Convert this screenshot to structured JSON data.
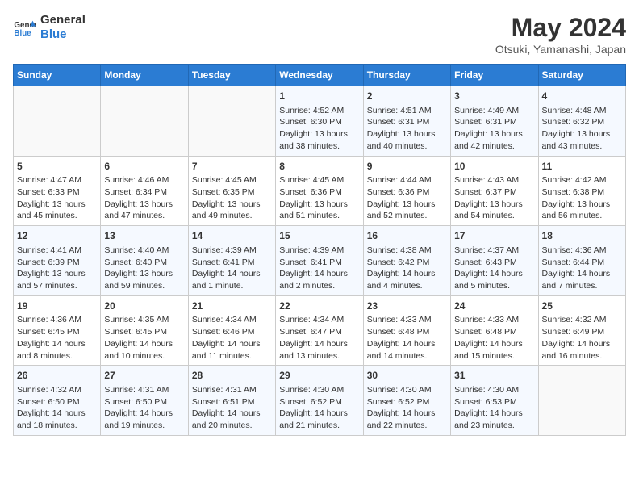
{
  "header": {
    "logo_line1": "General",
    "logo_line2": "Blue",
    "month_title": "May 2024",
    "location": "Otsuki, Yamanashi, Japan"
  },
  "days_of_week": [
    "Sunday",
    "Monday",
    "Tuesday",
    "Wednesday",
    "Thursday",
    "Friday",
    "Saturday"
  ],
  "weeks": [
    [
      {
        "day": "",
        "sunrise": "",
        "sunset": "",
        "daylight": ""
      },
      {
        "day": "",
        "sunrise": "",
        "sunset": "",
        "daylight": ""
      },
      {
        "day": "",
        "sunrise": "",
        "sunset": "",
        "daylight": ""
      },
      {
        "day": "1",
        "sunrise": "Sunrise: 4:52 AM",
        "sunset": "Sunset: 6:30 PM",
        "daylight": "Daylight: 13 hours and 38 minutes."
      },
      {
        "day": "2",
        "sunrise": "Sunrise: 4:51 AM",
        "sunset": "Sunset: 6:31 PM",
        "daylight": "Daylight: 13 hours and 40 minutes."
      },
      {
        "day": "3",
        "sunrise": "Sunrise: 4:49 AM",
        "sunset": "Sunset: 6:31 PM",
        "daylight": "Daylight: 13 hours and 42 minutes."
      },
      {
        "day": "4",
        "sunrise": "Sunrise: 4:48 AM",
        "sunset": "Sunset: 6:32 PM",
        "daylight": "Daylight: 13 hours and 43 minutes."
      }
    ],
    [
      {
        "day": "5",
        "sunrise": "Sunrise: 4:47 AM",
        "sunset": "Sunset: 6:33 PM",
        "daylight": "Daylight: 13 hours and 45 minutes."
      },
      {
        "day": "6",
        "sunrise": "Sunrise: 4:46 AM",
        "sunset": "Sunset: 6:34 PM",
        "daylight": "Daylight: 13 hours and 47 minutes."
      },
      {
        "day": "7",
        "sunrise": "Sunrise: 4:45 AM",
        "sunset": "Sunset: 6:35 PM",
        "daylight": "Daylight: 13 hours and 49 minutes."
      },
      {
        "day": "8",
        "sunrise": "Sunrise: 4:45 AM",
        "sunset": "Sunset: 6:36 PM",
        "daylight": "Daylight: 13 hours and 51 minutes."
      },
      {
        "day": "9",
        "sunrise": "Sunrise: 4:44 AM",
        "sunset": "Sunset: 6:36 PM",
        "daylight": "Daylight: 13 hours and 52 minutes."
      },
      {
        "day": "10",
        "sunrise": "Sunrise: 4:43 AM",
        "sunset": "Sunset: 6:37 PM",
        "daylight": "Daylight: 13 hours and 54 minutes."
      },
      {
        "day": "11",
        "sunrise": "Sunrise: 4:42 AM",
        "sunset": "Sunset: 6:38 PM",
        "daylight": "Daylight: 13 hours and 56 minutes."
      }
    ],
    [
      {
        "day": "12",
        "sunrise": "Sunrise: 4:41 AM",
        "sunset": "Sunset: 6:39 PM",
        "daylight": "Daylight: 13 hours and 57 minutes."
      },
      {
        "day": "13",
        "sunrise": "Sunrise: 4:40 AM",
        "sunset": "Sunset: 6:40 PM",
        "daylight": "Daylight: 13 hours and 59 minutes."
      },
      {
        "day": "14",
        "sunrise": "Sunrise: 4:39 AM",
        "sunset": "Sunset: 6:41 PM",
        "daylight": "Daylight: 14 hours and 1 minute."
      },
      {
        "day": "15",
        "sunrise": "Sunrise: 4:39 AM",
        "sunset": "Sunset: 6:41 PM",
        "daylight": "Daylight: 14 hours and 2 minutes."
      },
      {
        "day": "16",
        "sunrise": "Sunrise: 4:38 AM",
        "sunset": "Sunset: 6:42 PM",
        "daylight": "Daylight: 14 hours and 4 minutes."
      },
      {
        "day": "17",
        "sunrise": "Sunrise: 4:37 AM",
        "sunset": "Sunset: 6:43 PM",
        "daylight": "Daylight: 14 hours and 5 minutes."
      },
      {
        "day": "18",
        "sunrise": "Sunrise: 4:36 AM",
        "sunset": "Sunset: 6:44 PM",
        "daylight": "Daylight: 14 hours and 7 minutes."
      }
    ],
    [
      {
        "day": "19",
        "sunrise": "Sunrise: 4:36 AM",
        "sunset": "Sunset: 6:45 PM",
        "daylight": "Daylight: 14 hours and 8 minutes."
      },
      {
        "day": "20",
        "sunrise": "Sunrise: 4:35 AM",
        "sunset": "Sunset: 6:45 PM",
        "daylight": "Daylight: 14 hours and 10 minutes."
      },
      {
        "day": "21",
        "sunrise": "Sunrise: 4:34 AM",
        "sunset": "Sunset: 6:46 PM",
        "daylight": "Daylight: 14 hours and 11 minutes."
      },
      {
        "day": "22",
        "sunrise": "Sunrise: 4:34 AM",
        "sunset": "Sunset: 6:47 PM",
        "daylight": "Daylight: 14 hours and 13 minutes."
      },
      {
        "day": "23",
        "sunrise": "Sunrise: 4:33 AM",
        "sunset": "Sunset: 6:48 PM",
        "daylight": "Daylight: 14 hours and 14 minutes."
      },
      {
        "day": "24",
        "sunrise": "Sunrise: 4:33 AM",
        "sunset": "Sunset: 6:48 PM",
        "daylight": "Daylight: 14 hours and 15 minutes."
      },
      {
        "day": "25",
        "sunrise": "Sunrise: 4:32 AM",
        "sunset": "Sunset: 6:49 PM",
        "daylight": "Daylight: 14 hours and 16 minutes."
      }
    ],
    [
      {
        "day": "26",
        "sunrise": "Sunrise: 4:32 AM",
        "sunset": "Sunset: 6:50 PM",
        "daylight": "Daylight: 14 hours and 18 minutes."
      },
      {
        "day": "27",
        "sunrise": "Sunrise: 4:31 AM",
        "sunset": "Sunset: 6:50 PM",
        "daylight": "Daylight: 14 hours and 19 minutes."
      },
      {
        "day": "28",
        "sunrise": "Sunrise: 4:31 AM",
        "sunset": "Sunset: 6:51 PM",
        "daylight": "Daylight: 14 hours and 20 minutes."
      },
      {
        "day": "29",
        "sunrise": "Sunrise: 4:30 AM",
        "sunset": "Sunset: 6:52 PM",
        "daylight": "Daylight: 14 hours and 21 minutes."
      },
      {
        "day": "30",
        "sunrise": "Sunrise: 4:30 AM",
        "sunset": "Sunset: 6:52 PM",
        "daylight": "Daylight: 14 hours and 22 minutes."
      },
      {
        "day": "31",
        "sunrise": "Sunrise: 4:30 AM",
        "sunset": "Sunset: 6:53 PM",
        "daylight": "Daylight: 14 hours and 23 minutes."
      },
      {
        "day": "",
        "sunrise": "",
        "sunset": "",
        "daylight": ""
      }
    ]
  ]
}
